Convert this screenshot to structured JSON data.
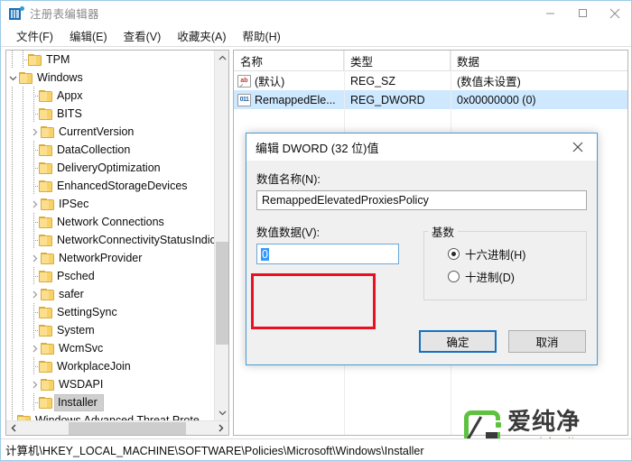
{
  "window": {
    "title": "注册表编辑器",
    "icon": "registry-icon",
    "controls": {
      "minimize": "minimize-icon",
      "maximize": "maximize-icon",
      "close": "close-icon"
    }
  },
  "menubar": {
    "items": [
      {
        "label": "文件(F)",
        "name": "file"
      },
      {
        "label": "编辑(E)",
        "name": "edit"
      },
      {
        "label": "查看(V)",
        "name": "view"
      },
      {
        "label": "收藏夹(A)",
        "name": "favorites"
      },
      {
        "label": "帮助(H)",
        "name": "help"
      }
    ]
  },
  "tree": {
    "items": [
      {
        "label": "TPM",
        "depth": 2,
        "chevron": "",
        "selected": false
      },
      {
        "label": "Windows",
        "depth": 1,
        "chevron": "v",
        "selected": false
      },
      {
        "label": "Appx",
        "depth": 3,
        "chevron": "",
        "selected": false
      },
      {
        "label": "BITS",
        "depth": 3,
        "chevron": "",
        "selected": false
      },
      {
        "label": "CurrentVersion",
        "depth": 3,
        "chevron": ">",
        "selected": false
      },
      {
        "label": "DataCollection",
        "depth": 3,
        "chevron": "",
        "selected": false
      },
      {
        "label": "DeliveryOptimization",
        "depth": 3,
        "chevron": "",
        "selected": false
      },
      {
        "label": "EnhancedStorageDevices",
        "depth": 3,
        "chevron": "",
        "selected": false
      },
      {
        "label": "IPSec",
        "depth": 3,
        "chevron": ">",
        "selected": false
      },
      {
        "label": "Network Connections",
        "depth": 3,
        "chevron": "",
        "selected": false
      },
      {
        "label": "NetworkConnectivityStatusIndicator",
        "depth": 3,
        "chevron": "",
        "selected": false
      },
      {
        "label": "NetworkProvider",
        "depth": 3,
        "chevron": ">",
        "selected": false
      },
      {
        "label": "Psched",
        "depth": 3,
        "chevron": "",
        "selected": false
      },
      {
        "label": "safer",
        "depth": 3,
        "chevron": ">",
        "selected": false
      },
      {
        "label": "SettingSync",
        "depth": 3,
        "chevron": "",
        "selected": false
      },
      {
        "label": "System",
        "depth": 3,
        "chevron": "",
        "selected": false
      },
      {
        "label": "WcmSvc",
        "depth": 3,
        "chevron": ">",
        "selected": false
      },
      {
        "label": "WorkplaceJoin",
        "depth": 3,
        "chevron": "",
        "selected": false
      },
      {
        "label": "WSDAPI",
        "depth": 3,
        "chevron": ">",
        "selected": false
      },
      {
        "label": "Installer",
        "depth": 3,
        "chevron": "",
        "selected": true
      },
      {
        "label": "Windows Advanced Threat Prote",
        "depth": 1,
        "chevron": "",
        "selected": false
      }
    ],
    "scroll_up_icon": "chevron-up-icon",
    "scroll_down_icon": "chevron-down-icon",
    "scroll_left_icon": "chevron-left-icon",
    "scroll_right_icon": "chevron-right-icon"
  },
  "list": {
    "columns": [
      "名称",
      "类型",
      "数据"
    ],
    "rows": [
      {
        "icon": "string-value-icon",
        "icon_glyph": "ab",
        "name": "(默认)",
        "type": "REG_SZ",
        "data": "(数值未设置)",
        "selected": false
      },
      {
        "icon": "dword-value-icon",
        "icon_glyph": "011",
        "name": "RemappedEle...",
        "type": "REG_DWORD",
        "data": "0x00000000 (0)",
        "selected": true
      }
    ]
  },
  "dialog": {
    "title": "编辑 DWORD (32 位)值",
    "close_icon": "close-icon",
    "name_label": "数值名称(N):",
    "name_value": "RemappedElevatedProxiesPolicy",
    "data_label": "数值数据(V):",
    "data_value": "0",
    "base_legend": "基数",
    "base_options": [
      {
        "label": "十六进制(H)",
        "selected": true
      },
      {
        "label": "十进制(D)",
        "selected": false
      }
    ],
    "ok_label": "确定",
    "cancel_label": "取消",
    "highlight_color": "#e81123"
  },
  "statusbar": {
    "path": "计算机\\HKEY_LOCAL_MACHINE\\SOFTWARE\\Policies\\Microsoft\\Windows\\Installer"
  },
  "watermark": {
    "brand": "爱纯净",
    "url": "www.aichunjing.com",
    "color": "#5ec13f"
  }
}
